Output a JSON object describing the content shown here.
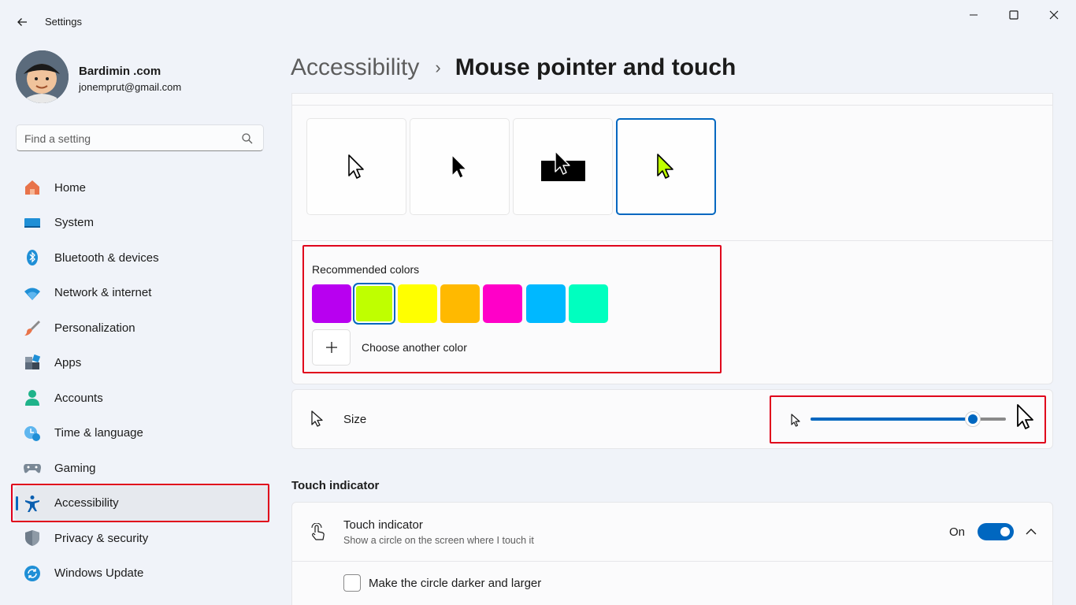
{
  "window": {
    "title": "Settings",
    "controls": [
      "minimize-icon",
      "maximize-icon",
      "close-icon"
    ]
  },
  "profile": {
    "name": "Bardimin .com",
    "email": "jonemprut@gmail.com"
  },
  "search": {
    "placeholder": "Find a setting"
  },
  "sidebar": {
    "items": [
      {
        "label": "Home",
        "icon": "home-icon"
      },
      {
        "label": "System",
        "icon": "system-icon"
      },
      {
        "label": "Bluetooth & devices",
        "icon": "bluetooth-icon"
      },
      {
        "label": "Network & internet",
        "icon": "wifi-icon"
      },
      {
        "label": "Personalization",
        "icon": "brush-icon"
      },
      {
        "label": "Apps",
        "icon": "apps-icon"
      },
      {
        "label": "Accounts",
        "icon": "accounts-icon"
      },
      {
        "label": "Time & language",
        "icon": "time-language-icon"
      },
      {
        "label": "Gaming",
        "icon": "gamepad-icon"
      },
      {
        "label": "Accessibility",
        "icon": "accessibility-icon"
      },
      {
        "label": "Privacy & security",
        "icon": "shield-icon"
      },
      {
        "label": "Windows Update",
        "icon": "update-icon"
      }
    ],
    "active": "Accessibility"
  },
  "breadcrumb": {
    "parent": "Accessibility",
    "separator": "›",
    "current": "Mouse pointer and touch"
  },
  "pointer_styles": {
    "options": [
      "white",
      "black",
      "inverted",
      "custom"
    ],
    "selected": "custom"
  },
  "colors": {
    "label": "Recommended colors",
    "swatches": [
      "#b800f0",
      "#bfff00",
      "#ffff00",
      "#ffb900",
      "#ff00c8",
      "#00b8ff",
      "#00ffbf"
    ],
    "selected_index": 1,
    "choose_label": "Choose another color",
    "accent": "#0067c0",
    "highlight": "#e0001b"
  },
  "size": {
    "label": "Size",
    "value_fraction": 0.83
  },
  "touch": {
    "section_title": "Touch indicator",
    "title": "Touch indicator",
    "description": "Show a circle on the screen where I touch it",
    "state": "On",
    "checkbox_label": "Make the circle darker and larger"
  }
}
